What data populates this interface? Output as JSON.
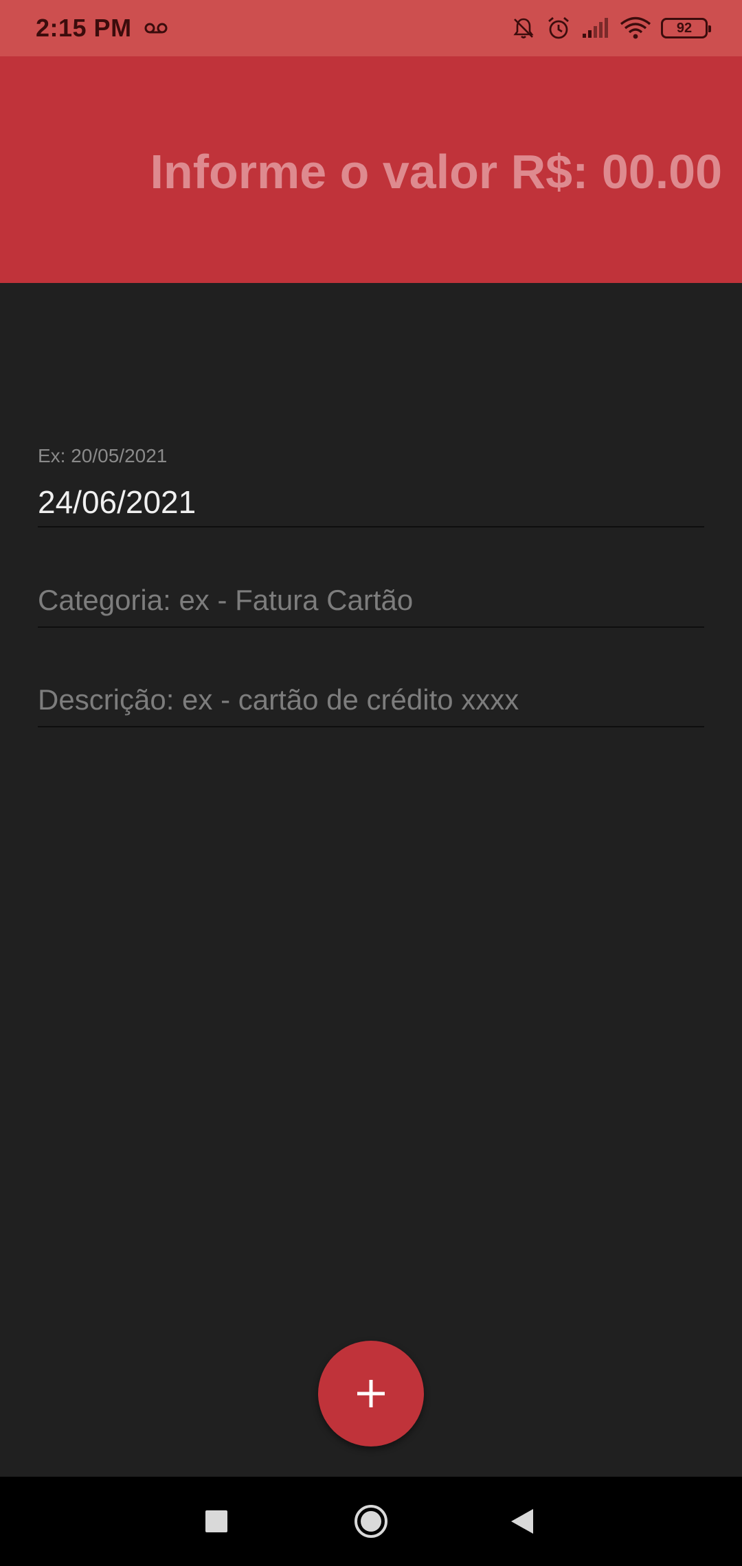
{
  "status_bar": {
    "time": "2:15 PM",
    "battery": "92",
    "icons": [
      "voicemail-icon",
      "bell-muted-icon",
      "alarm-icon",
      "signal-icon",
      "wifi-icon",
      "battery-icon"
    ]
  },
  "header": {
    "amount_text": "Informe o valor R$: 00.00"
  },
  "form": {
    "date": {
      "label": "Ex: 20/05/2021",
      "value": "24/06/2021"
    },
    "category": {
      "placeholder": "Categoria: ex - Fatura Cartão"
    },
    "description": {
      "placeholder": "Descrição: ex - cartão de crédito xxxx"
    }
  },
  "fab": {
    "icon": "plus-icon"
  },
  "nav_bar": {
    "icons": [
      "recents-icon",
      "home-icon",
      "back-icon"
    ]
  },
  "colors": {
    "status_bar": "#cd4f4f",
    "header": "#c0333a",
    "amount_text": "#de8a8f",
    "background": "#202020",
    "fab": "#c0333a",
    "nav_bar": "#000000"
  }
}
